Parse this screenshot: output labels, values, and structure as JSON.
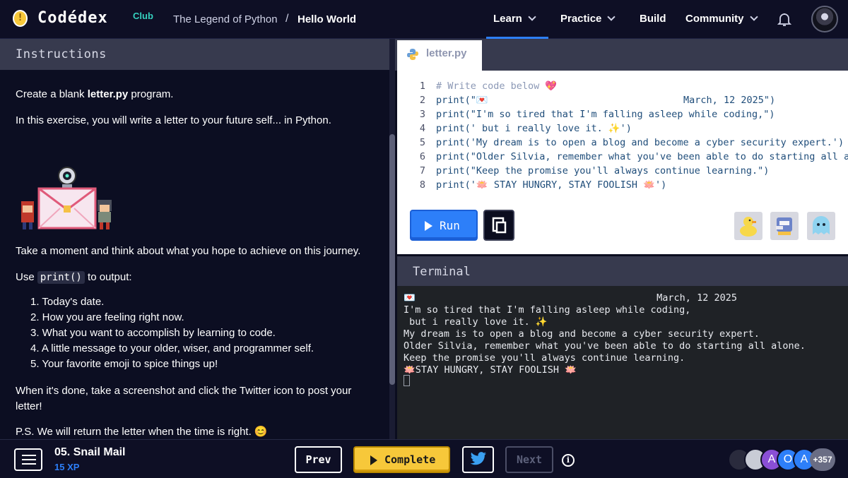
{
  "header": {
    "brand": "Codédex",
    "brand_tag": "Club",
    "breadcrumb_course": "The Legend of Python",
    "breadcrumb_sep": "/",
    "breadcrumb_lesson": "Hello World",
    "nav": {
      "learn": "Learn",
      "practice": "Practice",
      "build": "Build",
      "community": "Community"
    },
    "active_nav": "Learn"
  },
  "instructions": {
    "title": "Instructions",
    "p1_pre": "Create a blank ",
    "p1_bold": "letter.py",
    "p1_post": " program.",
    "p2": "In this exercise, you will write a letter to your future self... in Python.",
    "p3": "Take a moment and think about what you hope to achieve on this journey.",
    "p4_pre": "Use ",
    "p4_code": "print()",
    "p4_post": " to output:",
    "list": [
      "1. Today's date.",
      "2. How you are feeling right now.",
      "3. What you want to accomplish by learning to code.",
      "4. A little message to your older, wiser, and programmer self.",
      "5. Your favorite emoji to spice things up!"
    ],
    "p5_line1": "When it's done, take a screenshot and click the Twitter icon to post your",
    "p5_line2": "letter!",
    "p6": "P.S. We will return the letter when the time is right. 😊"
  },
  "editor": {
    "file_tab": "letter.py",
    "lines": [
      {
        "n": "1",
        "text": "# Write code below 💖",
        "kind": "comment"
      },
      {
        "n": "2",
        "text": "print(\"💌                                  March, 12 2025\")",
        "kind": "code"
      },
      {
        "n": "3",
        "text": "print(\"I'm so tired that I'm falling asleep while coding,\")",
        "kind": "code"
      },
      {
        "n": "4",
        "text": "print(' but i really love it. ✨')",
        "kind": "code"
      },
      {
        "n": "5",
        "text": "print('My dream is to open a blog and become a cyber security expert.')",
        "kind": "code"
      },
      {
        "n": "6",
        "text": "print(\"Older Silvia, remember what you've been able to do starting all alone.\")",
        "kind": "code"
      },
      {
        "n": "7",
        "text": "print(\"Keep the promise you'll always continue learning.\")",
        "kind": "code"
      },
      {
        "n": "8",
        "text": "print('🪷 STAY HUNGRY, STAY FOOLISH 🪷')",
        "kind": "code"
      }
    ],
    "run_label": "Run"
  },
  "terminal": {
    "title": "Terminal",
    "lines": [
      "💌                                          March, 12 2025",
      "I'm so tired that I'm falling asleep while coding,",
      " but i really love it. ✨",
      "My dream is to open a blog and become a cyber security expert.",
      "Older Silvia, remember what you've been able to do starting all alone.",
      "Keep the promise you'll always continue learning.",
      "🪷STAY HUNGRY, STAY FOOLISH 🪷"
    ]
  },
  "bottom": {
    "lesson_title": "05. Snail Mail",
    "lesson_xp": "15 XP",
    "prev_label": "Prev",
    "complete_label": "Complete",
    "next_label": "Next",
    "info_glyph": "i",
    "avatars": [
      {
        "initial": "",
        "color": "#2a2b3d"
      },
      {
        "initial": "",
        "color": "#c9ccd6"
      },
      {
        "initial": "A",
        "color": "#8a4fd6"
      },
      {
        "initial": "O",
        "color": "#2d7ff9"
      },
      {
        "initial": "A",
        "color": "#2d7ff9"
      }
    ],
    "more_count": "+357"
  },
  "colors": {
    "accent_blue": "#2d7ff9",
    "accent_yellow": "#f7c83a",
    "club_teal": "#35d1bf"
  }
}
